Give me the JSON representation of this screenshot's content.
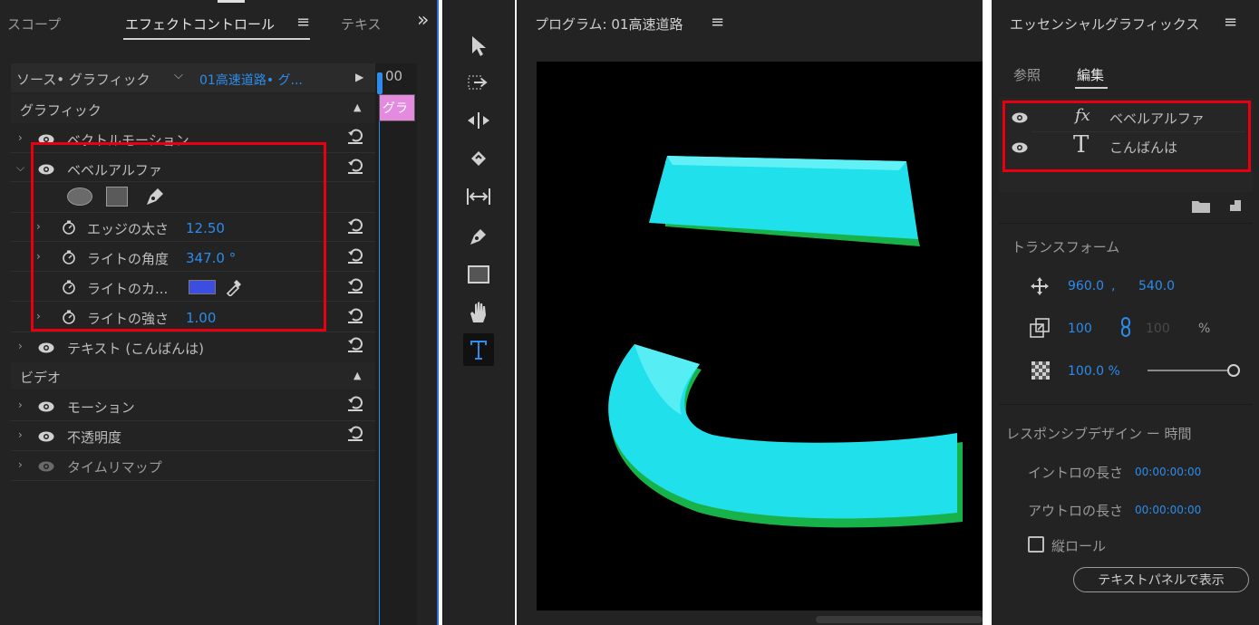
{
  "left_panel": {
    "tabs": [
      "スコープ",
      "エフェクトコントロール",
      "テキス"
    ],
    "menu_glyph": "≡",
    "overflow_glyph": "»",
    "source_label": "ソース• グラフィック",
    "clip_label": "01高速道路• グ...",
    "timecode": "00",
    "clip_chip": "グラ",
    "sections": {
      "graphic": "グラフィック",
      "video": "ビデオ"
    },
    "rows": {
      "vector_motion": "ベクトルモーション",
      "bevel_alpha": "ベベルアルファ",
      "edge_label": "エッジの太さ",
      "edge_value": "12.50",
      "angle_label": "ライトの角度",
      "angle_value": "347.0 °",
      "color_label": "ライトのカ...",
      "strength_label": "ライトの強さ",
      "strength_value": "1.00",
      "text_layer": "テキスト (こんばんは)",
      "motion": "モーション",
      "opacity": "不透明度",
      "time_remap": "タイムリマップ"
    },
    "colors": {
      "light_color": "#3c4ee0",
      "chip": "#e48be0"
    }
  },
  "program": {
    "title": "プログラム: 01高速道路",
    "menu_glyph": "≡",
    "glyph_color": "#1fe6f0",
    "glyph_shadow": "#17b34a"
  },
  "tools": [
    "selection-tool",
    "track-select-tool",
    "ripple-edit-tool",
    "razor-tool",
    "slip-tool",
    "pen-tool",
    "rectangle-tool",
    "hand-tool",
    "type-tool"
  ],
  "right_panel": {
    "title": "エッセンシャルグラフィックス",
    "menu_glyph": "≡",
    "tabs": [
      "参照",
      "編集"
    ],
    "layers": [
      {
        "icon": "fx",
        "name": "ベベルアルファ"
      },
      {
        "icon": "T",
        "name": "こんばんは"
      }
    ],
    "transform_label": "トランスフォーム",
    "pos_x": "960.0",
    "pos_sep": ",",
    "pos_y": "540.0",
    "scale": "100",
    "scale_linked": "100",
    "percent": "%",
    "opacity_value": "100.0 %",
    "responsive_label": "レスポンシブデザイン ー 時間",
    "intro_label": "イントロの長さ",
    "intro_value": "00:00:00:00",
    "outro_label": "アウトロの長さ",
    "outro_value": "00:00:00:00",
    "roll_label": "縦ロール",
    "text_panel_button": "テキストパネルで表示"
  }
}
